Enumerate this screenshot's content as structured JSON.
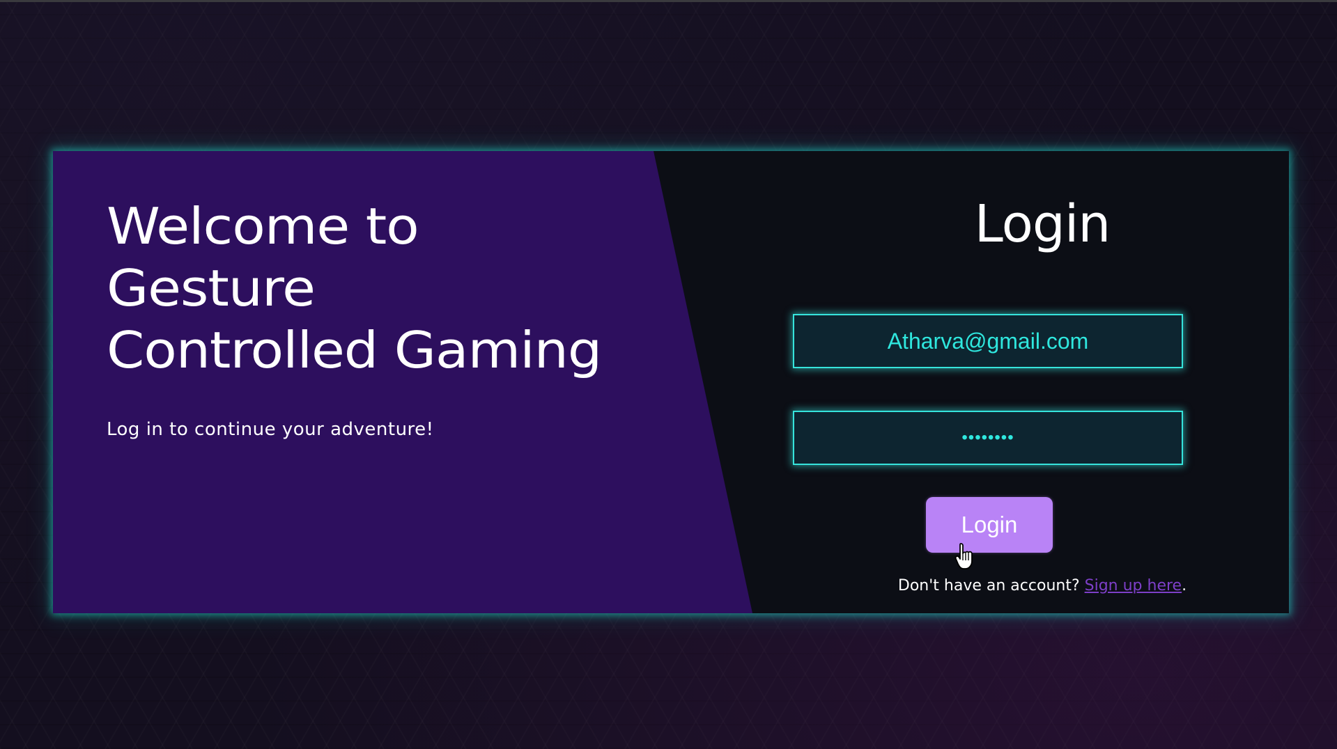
{
  "welcome": {
    "title_line1": "Welcome to",
    "title_line2": "Gesture",
    "title_line3": "Controlled Gaming",
    "subtitle": "Log in to continue your adventure!"
  },
  "login": {
    "title": "Login",
    "email_value": "Atharva@gmail.com",
    "password_mask": "••••••••",
    "button_label": "Login",
    "signup_prompt": "Don't have an account? ",
    "signup_link": "Sign up here",
    "signup_suffix": "."
  },
  "icons": {
    "cursor": "hand-pointer-icon"
  },
  "colors": {
    "panel_purple": "#2d0f5e",
    "card_dark": "#0c0e15",
    "neon_cyan": "#36e4dc",
    "button_purple": "#b983f6",
    "link_purple": "#7d3fc8"
  }
}
